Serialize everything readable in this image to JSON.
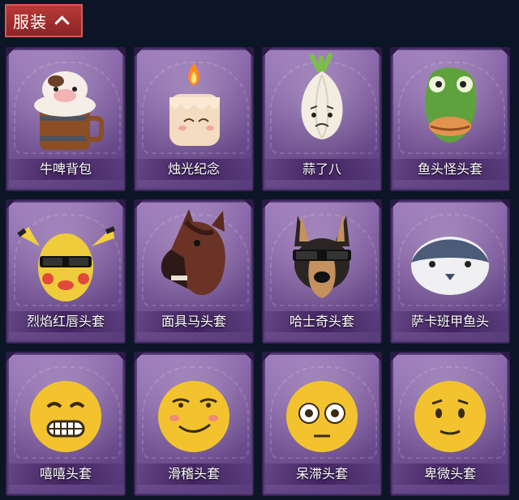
{
  "header": {
    "title": "服装"
  },
  "items": [
    {
      "label": "牛啤背包"
    },
    {
      "label": "烛光纪念"
    },
    {
      "label": "蒜了八"
    },
    {
      "label": "鱼头怪头套"
    },
    {
      "label": "烈焰红唇头套"
    },
    {
      "label": "面具马头套"
    },
    {
      "label": "哈士奇头套"
    },
    {
      "label": "萨卡班甲鱼头"
    },
    {
      "label": "嘻嘻头套"
    },
    {
      "label": "滑稽头套"
    },
    {
      "label": "呆滞头套"
    },
    {
      "label": "卑微头套"
    }
  ]
}
